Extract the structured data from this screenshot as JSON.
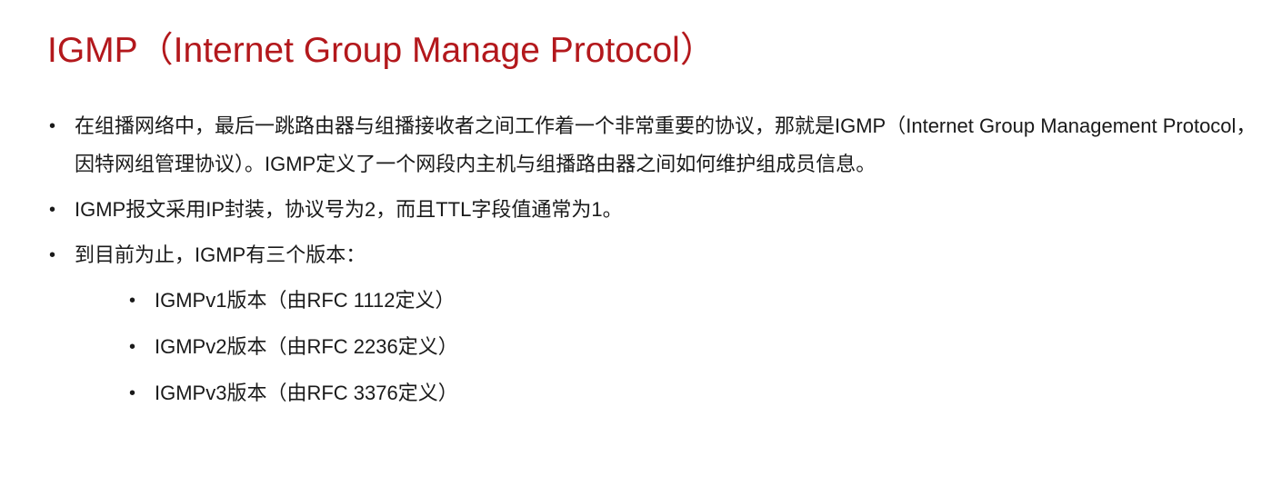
{
  "slide": {
    "title": "IGMP（Internet Group Manage Protocol）",
    "bullets": [
      {
        "text": "在组播网络中，最后一跳路由器与组播接收者之间工作着一个非常重要的协议，那就是IGMP（Internet Group Management Protocol，因特网组管理协议）。IGMP定义了一个网段内主机与组播路由器之间如何维护组成员信息。"
      },
      {
        "text": "IGMP报文采用IP封装，协议号为2，而且TTL字段值通常为1。"
      },
      {
        "text": "到目前为止，IGMP有三个版本："
      }
    ],
    "sub_bullets": [
      {
        "text": "IGMPv1版本（由RFC 1112定义）"
      },
      {
        "text": "IGMPv2版本（由RFC 2236定义）"
      },
      {
        "text": "IGMPv3版本（由RFC 3376定义）"
      }
    ],
    "bullet_symbol": "•"
  }
}
